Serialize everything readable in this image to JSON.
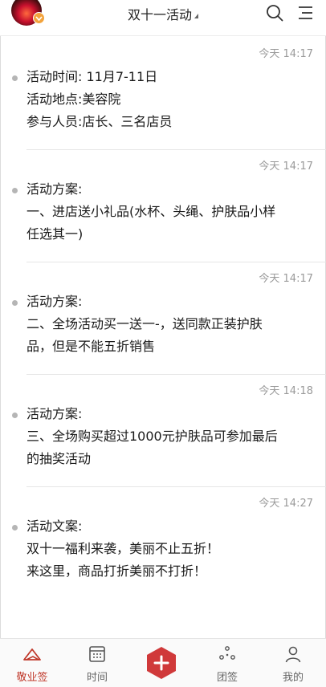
{
  "header": {
    "title": "双十一活动",
    "colors": {
      "accent": "#c0392b",
      "badge": "#f3a33c"
    }
  },
  "messages": [
    {
      "time": "今天 14:17",
      "lines": [
        "活动时间: 11月7-11日",
        "活动地点:美容院",
        "参与人员:店长、三名店员"
      ]
    },
    {
      "time": "今天 14:17",
      "lines": [
        "活动方案:",
        "一、进店送小礼品(水杯、头绳、护肤品小样",
        "任选其一)"
      ]
    },
    {
      "time": "今天 14:17",
      "lines": [
        "活动方案:",
        "二、全场活动买一送一-，送同款正装护肤",
        "品，但是不能五折销售"
      ]
    },
    {
      "time": "今天 14:18",
      "lines": [
        "活动方案:",
        "三、全场购买超过1000元护肤品可参加最后",
        "的抽奖活动"
      ]
    },
    {
      "time": "今天 14:27",
      "lines": [
        "活动文案:",
        "双十一福利来袭，美丽不止五折！",
        "来这里，商品打折美丽不打折！"
      ]
    }
  ],
  "tabbar": {
    "items": [
      {
        "label": "敬业签",
        "icon": "home-icon",
        "active": true
      },
      {
        "label": "时间",
        "icon": "calendar-icon",
        "active": false
      },
      {
        "label": "",
        "icon": "plus-icon",
        "active": false
      },
      {
        "label": "团签",
        "icon": "team-icon",
        "active": false
      },
      {
        "label": "我的",
        "icon": "user-icon",
        "active": false
      }
    ]
  }
}
